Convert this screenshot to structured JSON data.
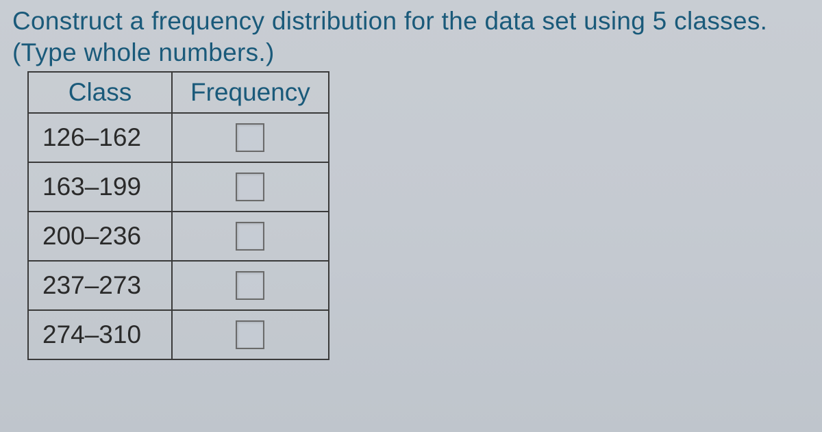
{
  "instruction": "Construct a frequency distribution for the data set using 5 classes.",
  "hint": "(Type whole numbers.)",
  "table": {
    "headers": {
      "class": "Class",
      "frequency": "Frequency"
    },
    "rows": [
      {
        "class_range": "126–162",
        "frequency": ""
      },
      {
        "class_range": "163–199",
        "frequency": ""
      },
      {
        "class_range": "200–236",
        "frequency": ""
      },
      {
        "class_range": "237–273",
        "frequency": ""
      },
      {
        "class_range": "274–310",
        "frequency": ""
      }
    ]
  }
}
